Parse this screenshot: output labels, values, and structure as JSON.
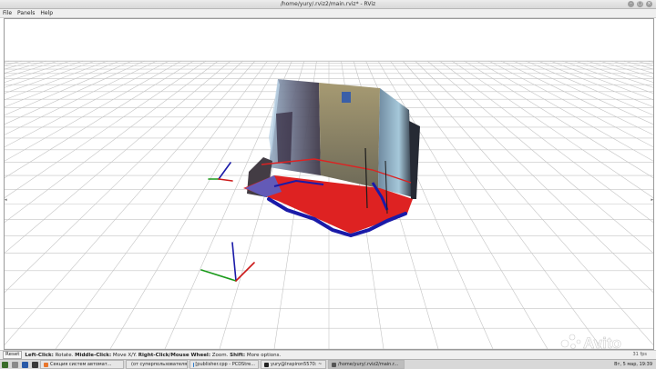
{
  "window": {
    "title": "/home/yury/.rviz2/main.rviz* - RViz"
  },
  "menu": {
    "items": [
      "File",
      "Panels",
      "Help"
    ]
  },
  "status": {
    "reset": "Reset",
    "left_label": "Left-Click:",
    "left_text": " Rotate. ",
    "middle_label": "Middle-Click:",
    "middle_text": " Move X/Y. ",
    "right_label": "Right-Click/Mouse Wheel:",
    "right_text": " Zoom. ",
    "shift_label": "Shift:",
    "shift_text": " More options.",
    "fps": "31 fps"
  },
  "taskbar": {
    "tasks": [
      "Секция систем автомат...",
      "(от суперпользователя)",
      "[publisher.cpp - PCDStre...",
      "yury@Inspiron5570: ~",
      "/home/yury/.rviz2/main.r..."
    ],
    "clock": "Вт, 5 мар, 19:39"
  },
  "watermark": {
    "text": "Avito"
  },
  "colors": {
    "accent_red": "#e02020",
    "axis_blue": "#1a1aa8",
    "grid": "#c4c4c4"
  }
}
